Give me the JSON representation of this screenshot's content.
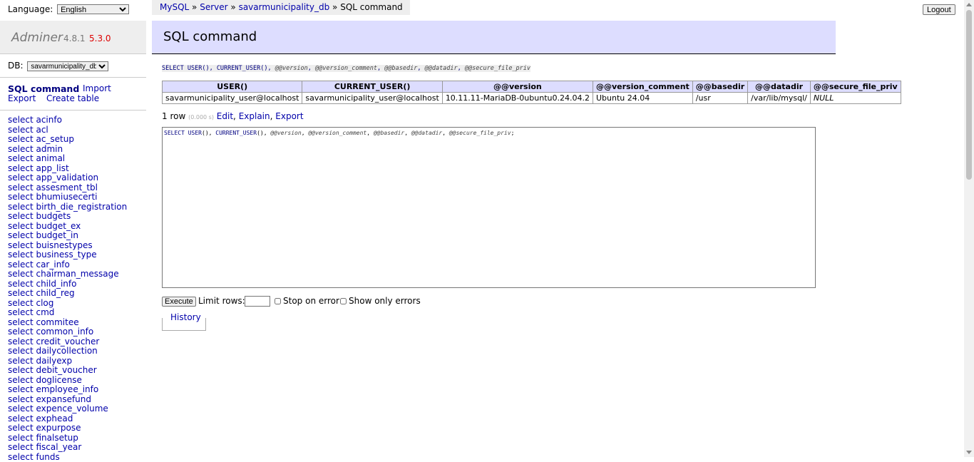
{
  "language": {
    "label": "Language:",
    "selected": "English"
  },
  "logo": {
    "name": "Adminer",
    "version": "4.8.1",
    "new_version": "5.3.0"
  },
  "db": {
    "label": "DB:",
    "selected": "savarmunicipality_db"
  },
  "menu": {
    "sql_command": "SQL command",
    "import": "Import",
    "export": "Export",
    "create_table": "Create table"
  },
  "tables": [
    "acinfo",
    "acl",
    "ac_setup",
    "admin",
    "animal",
    "app_list",
    "app_validation",
    "assesment_tbl",
    "bhumiusecerti",
    "birth_die_registration",
    "budgets",
    "budget_ex",
    "budget_in",
    "buisnestypes",
    "business_type",
    "car_info",
    "chairman_message",
    "child_info",
    "child_reg",
    "clog",
    "cmd",
    "commitee",
    "common_info",
    "credit_voucher",
    "dailycollection",
    "dailyexp",
    "debit_voucher",
    "doglicense",
    "employee_info",
    "expansefund",
    "expence_volume",
    "exphead",
    "expurpose",
    "finalsetup",
    "fiscal_year",
    "funds"
  ],
  "select_prefix": "select",
  "breadcrumb": {
    "mysql": "MySQL",
    "sep": "»",
    "server": "Server",
    "db": "savarmunicipality_db",
    "current": "SQL command"
  },
  "logout": "Logout",
  "heading": "SQL command",
  "query": {
    "kw1": "SELECT",
    "f1": "USER",
    "f2": "CURRENT_USER",
    "v1": "@@version",
    "v2": "@@version_comment",
    "v3": "@@basedir",
    "v4": "@@datadir",
    "v5": "@@secure_file_priv"
  },
  "results": {
    "headers": [
      "USER()",
      "CURRENT_USER()",
      "@@version",
      "@@version_comment",
      "@@basedir",
      "@@datadir",
      "@@secure_file_priv"
    ],
    "rows": [
      [
        "savarmunicipality_user@localhost",
        "savarmunicipality_user@localhost",
        "10.11.11-MariaDB-0ubuntu0.24.04.2",
        "Ubuntu 24.04",
        "/usr",
        "/var/lib/mysql/",
        "NULL"
      ]
    ]
  },
  "rowinfo": {
    "count": "1 row",
    "time": "(0.000 s)",
    "edit": "Edit",
    "explain": "Explain",
    "export": "Export"
  },
  "controls": {
    "execute": "Execute",
    "limit_label": "Limit rows:",
    "stop_on_error": "Stop on error",
    "show_only_errors": "Show only errors",
    "limit_value": ""
  },
  "history": "History"
}
